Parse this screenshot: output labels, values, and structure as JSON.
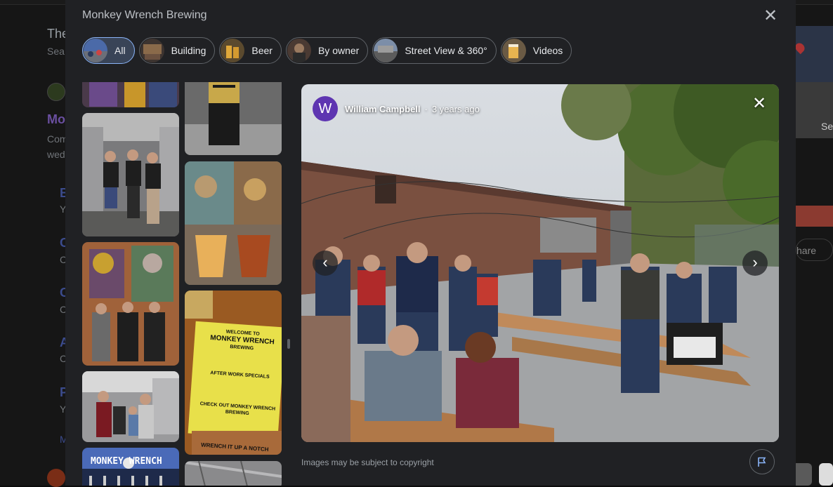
{
  "background": {
    "texts": [
      "The",
      "Sea",
      "Mo",
      "Com",
      "wed",
      "B",
      "Y",
      "C",
      "C",
      "C",
      "C",
      "A",
      "C",
      "P",
      "Y",
      "M"
    ],
    "share_label": "hare",
    "see_label": "Se"
  },
  "modal": {
    "title": "Monkey Wrench Brewing",
    "close_icon": "close-icon",
    "chips": [
      {
        "label": "All",
        "active": true
      },
      {
        "label": "Building",
        "active": false
      },
      {
        "label": "Beer",
        "active": false
      },
      {
        "label": "By owner",
        "active": false
      },
      {
        "label": "Street View & 360°",
        "active": false
      },
      {
        "label": "Videos",
        "active": false
      }
    ],
    "photo": {
      "author_initial": "W",
      "author_name": "William Campbell",
      "separator": "·",
      "time_ago": "3 years ago",
      "prev_icon": "chevron-left-icon",
      "next_icon": "chevron-right-icon",
      "close_icon": "close-icon"
    },
    "copyright_note": "Images may be subject to copyright",
    "flag_icon": "flag-icon",
    "thumbnails": [
      {
        "caption": "mural top",
        "col": 0
      },
      {
        "caption": "brewers in shirts",
        "col": 0
      },
      {
        "caption": "mural with people",
        "col": 0
      },
      {
        "caption": "family with beer",
        "col": 0
      },
      {
        "caption": "MONKEY WRENCH sign",
        "col": 0
      },
      {
        "caption": "beer can",
        "col": 1
      },
      {
        "caption": "beer flights",
        "col": 1
      },
      {
        "caption": "menu flyer",
        "col": 1
      },
      {
        "caption": "ceiling",
        "col": 1
      }
    ],
    "flyer_text": [
      "WELCOME TO",
      "MONKEY WRENCH",
      "BREWING",
      "AFTER WORK SPECIALS",
      "CHECK OUT MONKEY WRENCH BREWING",
      "WRENCH IT UP A NOTCH"
    ],
    "sign_text": "MONKEY WRENCH"
  },
  "colors": {
    "modal_bg": "#202124",
    "chip_active_bg": "#394457",
    "chip_active_border": "#8ab4f8",
    "avatar": "#5e35b1"
  }
}
